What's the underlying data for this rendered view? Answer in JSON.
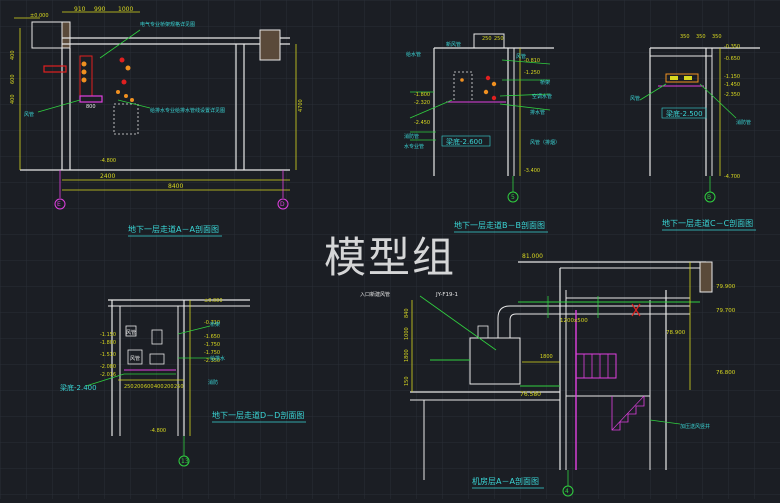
{
  "watermark": "模型组",
  "colors": {
    "background": "#1b1e24",
    "grid": "#2a2e36",
    "structure": "#e8e8e8",
    "dimension": "#d8d820",
    "annotation": "#3ad6d6",
    "leader": "#30d040",
    "equipment_red": "#e02020",
    "equipment_orange": "#f09020",
    "magenta": "#e040e0",
    "axis_circle": "#e040e0",
    "axis_circle_green": "#30d040",
    "title": "#3ad6d6"
  },
  "section_aa": {
    "title": "地下一层走道A－A剖面图",
    "top_dims": [
      "910",
      "990",
      "1000"
    ],
    "bottom_dims": [
      "2400",
      "8400"
    ],
    "left_dims": [
      "400",
      "600",
      "400"
    ],
    "side_dim": "4700",
    "elev_top": "±0.000",
    "elev_bottom": "-4.800",
    "notes": [
      "电气专业桥架规格详见图",
      "给排水专业给排水管线设置详见图"
    ],
    "label_left": "风管",
    "label_800": "800",
    "axis_left": "E",
    "axis_right": "D"
  },
  "section_bb": {
    "title": "地下一层走道B－B剖面图",
    "top_dims": [
      "250",
      "250"
    ],
    "elevs": [
      "-0.810",
      "-1.250",
      "-1.800",
      "-2.320",
      "-2.450",
      "-3.400"
    ],
    "floor_label": "梁底-2.600",
    "labels_left": [
      "给水管",
      "新风管",
      "消防管",
      "水专业管"
    ],
    "labels_right": [
      "风管",
      "桥架",
      "空调水管",
      "排水管",
      "风管（排烟）"
    ],
    "axis": "5"
  },
  "section_cc": {
    "title": "地下一层走道C－C剖面图",
    "top_dims": [
      "350",
      "350",
      "350"
    ],
    "elevs": [
      "-0.350",
      "-0.650",
      "-1.150",
      "-1.450",
      "-2.350",
      "-4.700"
    ],
    "floor_label": "梁底-2.500",
    "label_left": "风管",
    "label_right": "消防管",
    "axis": "B"
  },
  "section_dd": {
    "title": "地下一层走道D－D剖面图",
    "elevs": [
      "±0.000",
      "-0.710",
      "-1.650",
      "-1.750",
      "-1.750",
      "-2.350",
      "-1.800",
      "-2.080",
      "-1.510",
      "-1.150",
      "-2.016",
      "-4.800"
    ],
    "floor_label": "梁底-2.400",
    "bottom_dims": [
      "250",
      "200",
      "600",
      "400",
      "200",
      "250"
    ],
    "labels": [
      "风管",
      "桥架",
      "给排水",
      "消防",
      "风管"
    ],
    "axis": "13"
  },
  "section_machine": {
    "title": "机房层A－A剖面图",
    "elev_top": "81.000",
    "elevs_right": [
      "79.900",
      "79.700",
      "78.900",
      "76.800"
    ],
    "elev_bottom": "76.580",
    "equipment_label": "JY-F19-1",
    "duct_label": "入口新建风管",
    "duct_size": "1200x500",
    "dim_1800": "1800",
    "left_dims": [
      "840",
      "1000",
      "1800",
      "150"
    ],
    "label_right": "加压送风竖井",
    "axis": "4"
  }
}
